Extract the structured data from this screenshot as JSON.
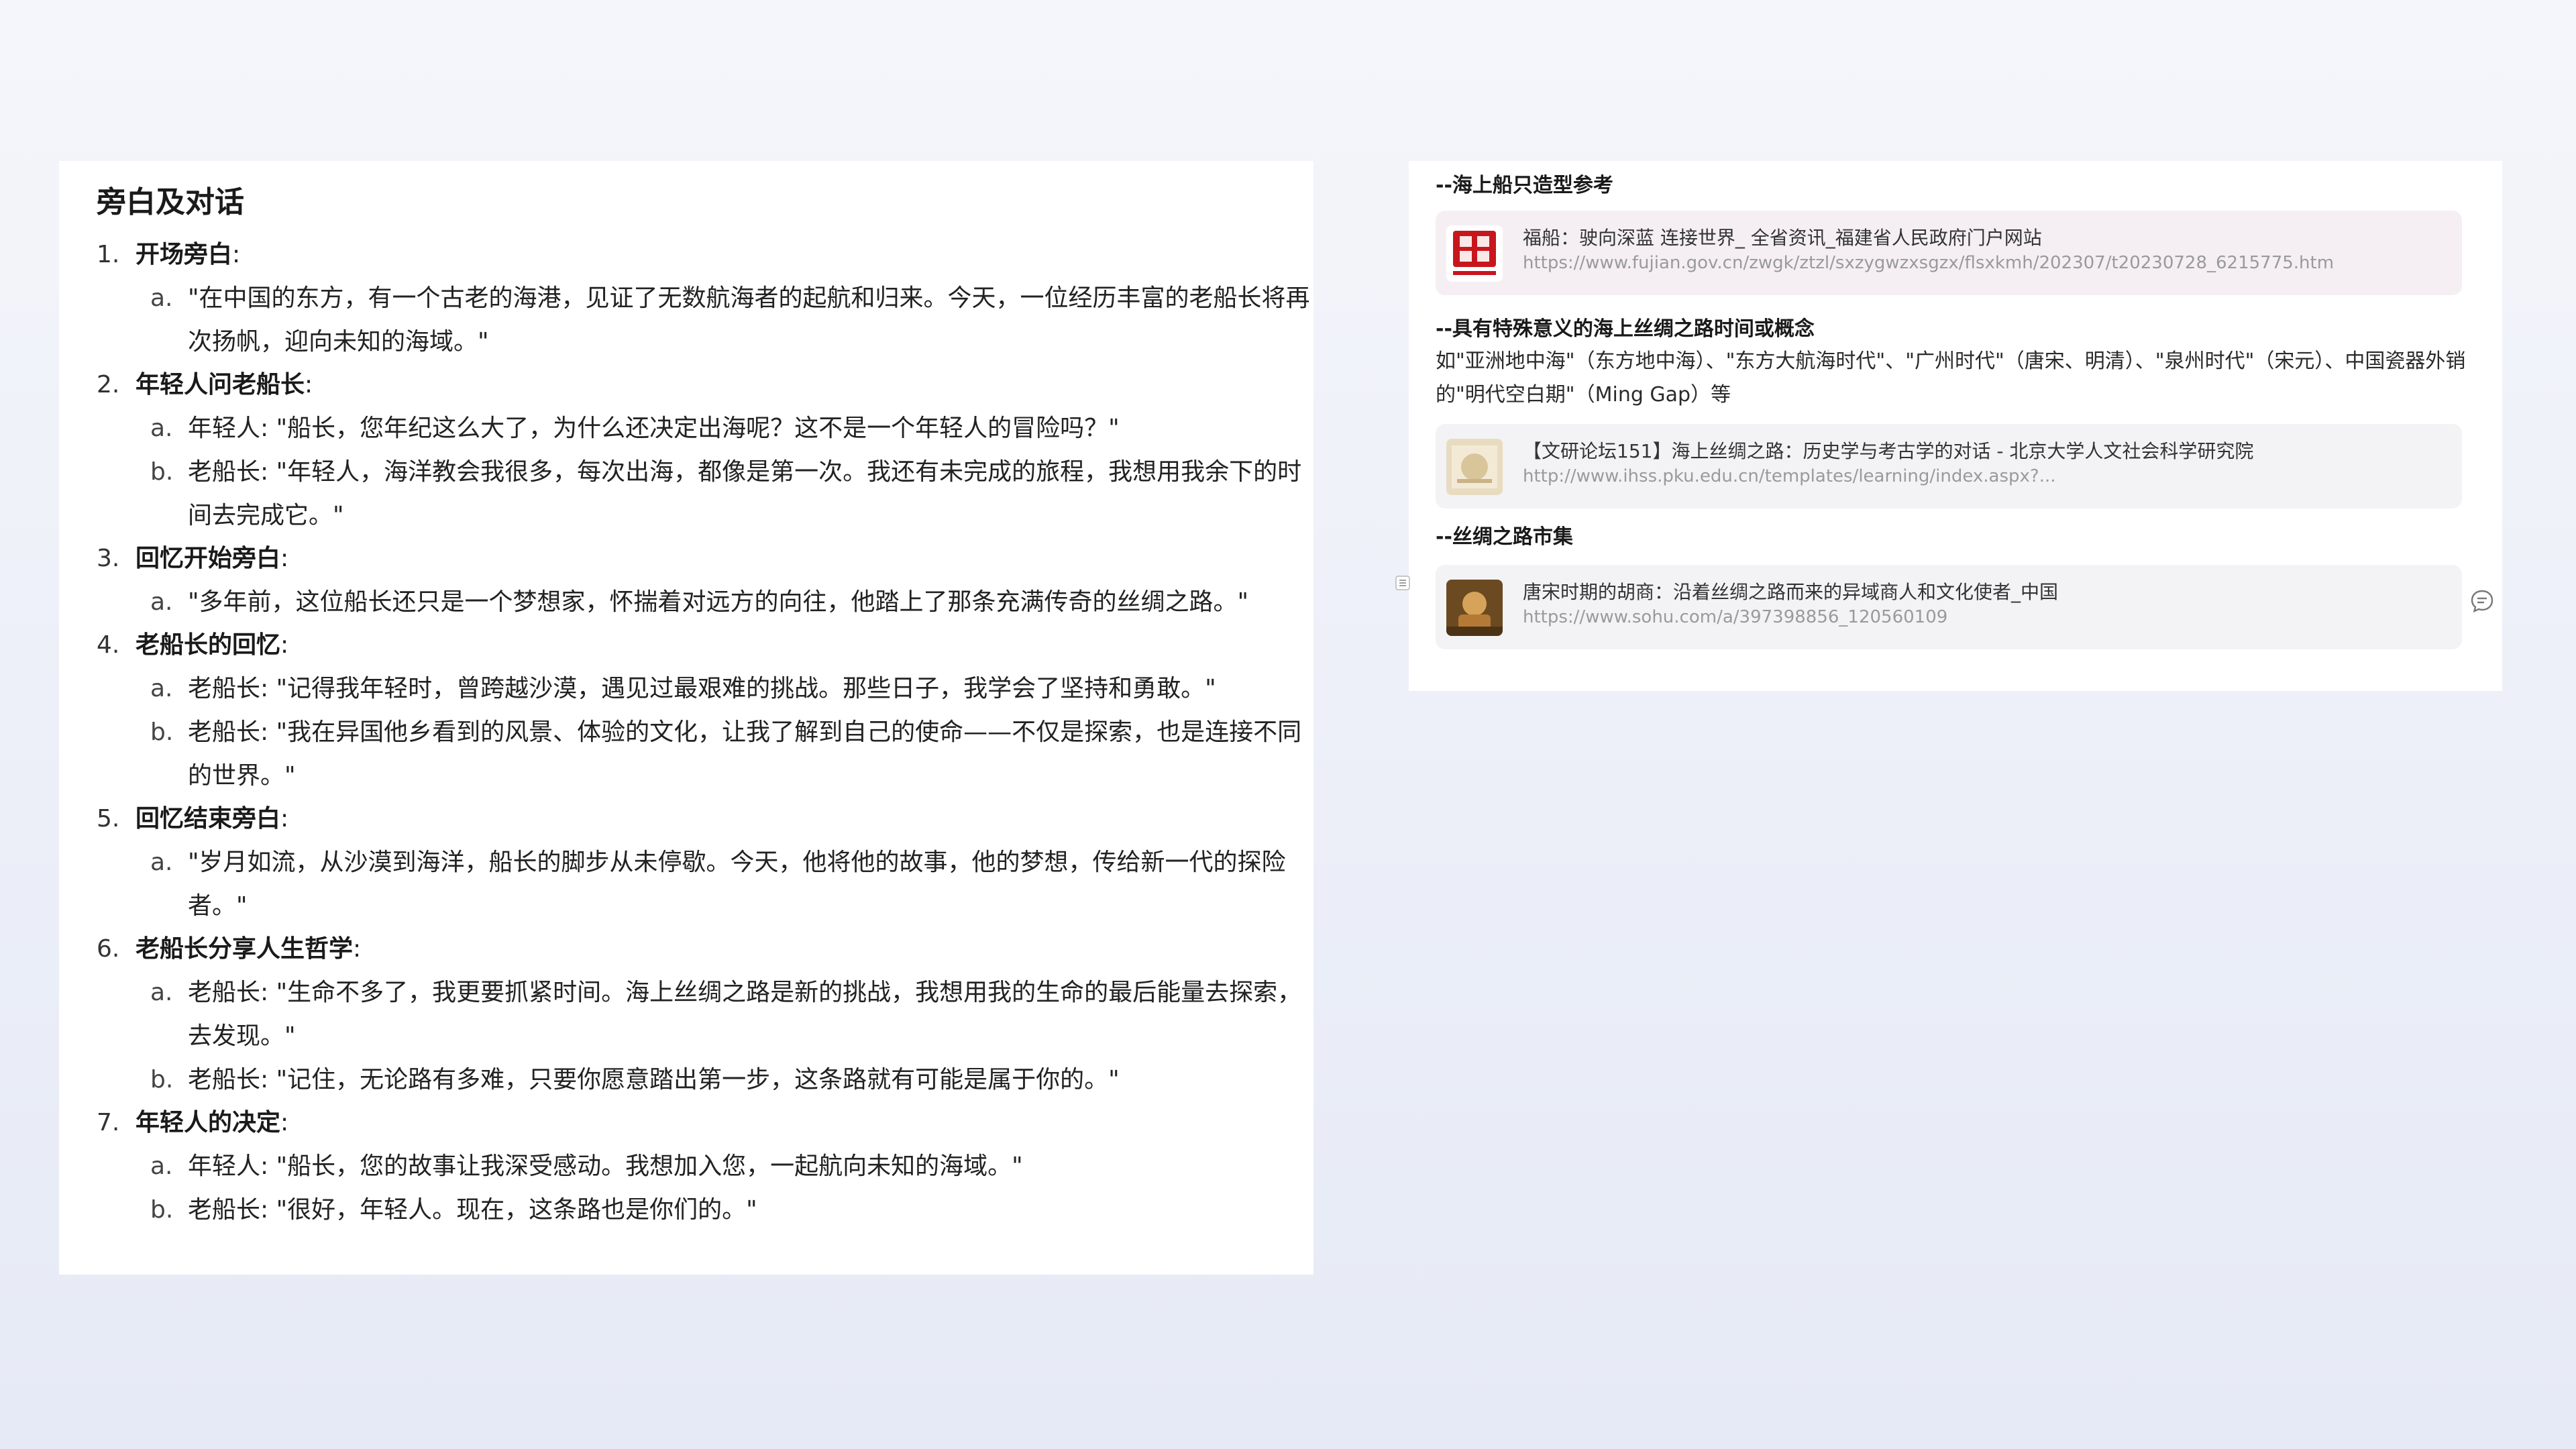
{
  "left": {
    "title": "旁白及对话",
    "sections": [
      {
        "num": "1.",
        "title": "开场旁白",
        "colon": ":",
        "lines": [
          {
            "letter": "a.",
            "text": "\"在中国的东方，有一个古老的海港，见证了无数航海者的起航和归来。今天，一位经历丰富的老船长将再次扬帆，迎向未知的海域。\""
          }
        ]
      },
      {
        "num": "2.",
        "title": "年轻人问老船长",
        "colon": ":",
        "lines": [
          {
            "letter": "a.",
            "text": "年轻人: \"船长，您年纪这么大了，为什么还决定出海呢？这不是一个年轻人的冒险吗？\""
          },
          {
            "letter": "b.",
            "text": "老船长: \"年轻人，海洋教会我很多，每次出海，都像是第一次。我还有未完成的旅程，我想用我余下的时间去完成它。\""
          }
        ]
      },
      {
        "num": "3.",
        "title": "回忆开始旁白",
        "colon": ":",
        "lines": [
          {
            "letter": "a.",
            "text": "\"多年前，这位船长还只是一个梦想家，怀揣着对远方的向往，他踏上了那条充满传奇的丝绸之路。\""
          }
        ]
      },
      {
        "num": "4.",
        "title": "老船长的回忆",
        "colon": ":",
        "lines": [
          {
            "letter": "a.",
            "text": "老船长: \"记得我年轻时，曾跨越沙漠，遇见过最艰难的挑战。那些日子，我学会了坚持和勇敢。\""
          },
          {
            "letter": "b.",
            "text": "老船长: \"我在异国他乡看到的风景、体验的文化，让我了解到自己的使命——不仅是探索，也是连接不同的世界。\""
          }
        ]
      },
      {
        "num": "5.",
        "title": "回忆结束旁白",
        "colon": ":",
        "lines": [
          {
            "letter": "a.",
            "text": "\"岁月如流，从沙漠到海洋，船长的脚步从未停歇。今天，他将他的故事，他的梦想，传给新一代的探险者。\""
          }
        ]
      },
      {
        "num": "6.",
        "title": "老船长分享人生哲学",
        "colon": ":",
        "lines": [
          {
            "letter": "a.",
            "text": "老船长: \"生命不多了，我更要抓紧时间。海上丝绸之路是新的挑战，我想用我的生命的最后能量去探索，去发现。\""
          },
          {
            "letter": "b.",
            "text": "老船长: \"记住，无论路有多难，只要你愿意踏出第一步，这条路就有可能是属于你的。\""
          }
        ]
      },
      {
        "num": "7.",
        "title": "年轻人的决定",
        "colon": ":",
        "lines": [
          {
            "letter": "a.",
            "text": "年轻人: \"船长，您的故事让我深受感动。我想加入您，一起航向未知的海域。\""
          },
          {
            "letter": "b.",
            "text": "老船长: \"很好，年轻人。现在，这条路也是你们的。\""
          }
        ]
      }
    ]
  },
  "right": {
    "heading1": "--海上船只造型参考",
    "card1": {
      "title": "福船：驶向深蓝 连接世界_ 全省资讯_福建省人民政府门户网站",
      "url": "https://www.fujian.gov.cn/zwgk/ztzl/sxzygwzxsgzx/flsxkmh/202307/t20230728_6215775.htm",
      "icon_name": "fujian-gov-logo-icon",
      "accent": "#c8161d"
    },
    "heading2": "--具有特殊意义的海上丝绸之路时间或概念",
    "description": "如\"亚洲地中海\"（东方地中海）、\"东方大航海时代\"、\"广州时代\"（唐宋、明清）、\"泉州时代\"（宋元）、中国瓷器外销的\"明代空白期\"（Ming Gap）等",
    "card2": {
      "title": "【文研论坛151】海上丝绸之路：历史学与考古学的对话 - 北京大学人文社会科学研究院",
      "url": "http://www.ihss.pku.edu.cn/templates/learning/index.aspx?...",
      "icon_name": "pku-ihss-thumbnail-icon"
    },
    "heading3": "--丝绸之路市集",
    "card3": {
      "title": "唐宋时期的胡商：沿着丝绸之路而来的异域商人和文化使者_中国",
      "url": "https://www.sohu.com/a/397398856_120560109",
      "icon_name": "sohu-article-thumbnail-icon"
    }
  }
}
